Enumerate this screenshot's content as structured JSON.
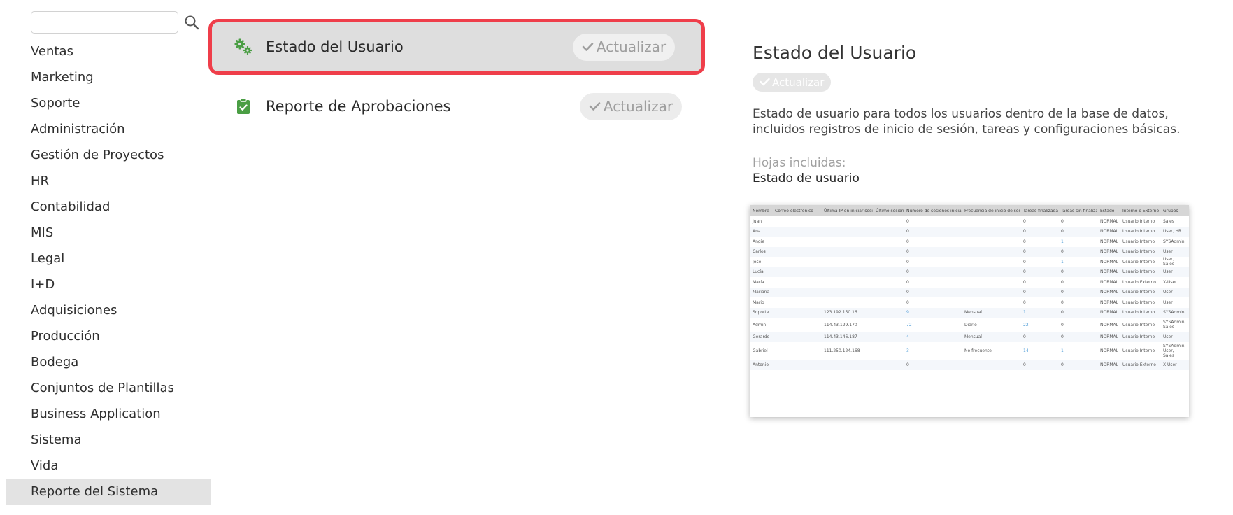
{
  "search": {
    "value": "",
    "placeholder": ""
  },
  "sidebar": {
    "items": [
      {
        "label": "Ventas",
        "active": false
      },
      {
        "label": "Marketing",
        "active": false
      },
      {
        "label": "Soporte",
        "active": false
      },
      {
        "label": "Administración",
        "active": false
      },
      {
        "label": "Gestión de Proyectos",
        "active": false
      },
      {
        "label": "HR",
        "active": false
      },
      {
        "label": "Contabilidad",
        "active": false
      },
      {
        "label": "MIS",
        "active": false
      },
      {
        "label": "Legal",
        "active": false
      },
      {
        "label": "I+D",
        "active": false
      },
      {
        "label": "Adquisiciones",
        "active": false
      },
      {
        "label": "Producción",
        "active": false
      },
      {
        "label": "Bodega",
        "active": false
      },
      {
        "label": "Conjuntos de Plantillas",
        "active": false
      },
      {
        "label": "Business Application",
        "active": false
      },
      {
        "label": "Sistema",
        "active": false
      },
      {
        "label": "Vida",
        "active": false
      },
      {
        "label": "Reporte del Sistema",
        "active": true
      }
    ]
  },
  "reports": [
    {
      "title": "Estado del Usuario",
      "button": "Actualizar",
      "icon": "gears-icon",
      "selected": true
    },
    {
      "title": "Reporte de Aprobaciones",
      "button": "Actualizar",
      "icon": "clipboard-check-icon",
      "selected": false
    }
  ],
  "detail": {
    "title": "Estado del Usuario",
    "badge": "Actualizar",
    "description": "Estado de usuario para todos los usuarios dentro de la base de datos, incluidos registros de inicio de sesión, tareas y configuraciones básicas.",
    "sheets_label": "Hojas incluidas:",
    "sheets_value": "Estado de usuario"
  },
  "preview": {
    "columns": [
      "Nombre",
      "Correo electrónico",
      "Última IP en iniciar sesión",
      "Último sesión",
      "Número de sesiones iniciadas",
      "Frecuencia de inicio de sesión",
      "Tareas finalizadas",
      "Tareas sin finalizar",
      "Estado",
      "Interno o Externo",
      "Grupos"
    ],
    "rows": [
      [
        "Juan",
        "",
        "",
        "",
        "0",
        "",
        "0",
        "0",
        "NORMAL",
        "Usuario Interno",
        "Sales"
      ],
      [
        "Ana",
        "",
        "",
        "",
        "0",
        "",
        "0",
        "0",
        "NORMAL",
        "Usuario Interno",
        "User, HR"
      ],
      [
        "Angie",
        "",
        "",
        "",
        "0",
        "",
        "0",
        "1",
        "NORMAL",
        "Usuario Interno",
        "SYSAdmin"
      ],
      [
        "Carlos",
        "",
        "",
        "",
        "0",
        "",
        "0",
        "0",
        "NORMAL",
        "Usuario Interno",
        "User"
      ],
      [
        "José",
        "",
        "",
        "",
        "0",
        "",
        "0",
        "1",
        "NORMAL",
        "Usuario Interno",
        "User, Sales"
      ],
      [
        "Lucía",
        "",
        "",
        "",
        "0",
        "",
        "0",
        "0",
        "NORMAL",
        "Usuario Interno",
        "User"
      ],
      [
        "María",
        "",
        "",
        "",
        "0",
        "",
        "0",
        "0",
        "NORMAL",
        "Usuario Externo",
        "X-User"
      ],
      [
        "Mariana",
        "",
        "",
        "",
        "0",
        "",
        "0",
        "0",
        "NORMAL",
        "Usuario Interno",
        "User"
      ],
      [
        "Mario",
        "",
        "",
        "",
        "0",
        "",
        "0",
        "0",
        "NORMAL",
        "Usuario Interno",
        "User"
      ],
      [
        "Soporte",
        "",
        "123.192.150.16",
        "",
        "9",
        "Mensual",
        "1",
        "0",
        "NORMAL",
        "Usuario Interno",
        "SYSAdmin"
      ],
      [
        "Admin",
        "",
        "114.43.129.170",
        "",
        "72",
        "Diario",
        "22",
        "0",
        "NORMAL",
        "Usuario Interno",
        "SYSAdmin, Sales"
      ],
      [
        "Gerardo",
        "",
        "114.43.146.187",
        "",
        "4",
        "Mensual",
        "0",
        "0",
        "NORMAL",
        "Usuario Interno",
        "User"
      ],
      [
        "Gabriel",
        "",
        "111.250.124.168",
        "",
        "3",
        "No frecuente",
        "14",
        "1",
        "NORMAL",
        "Usuario Interno",
        "SYSAdmin, User, Sales"
      ],
      [
        "Antonio",
        "",
        "",
        "",
        "0",
        "",
        "0",
        "0",
        "NORMAL",
        "Usuario Externo",
        "X-User"
      ]
    ],
    "link_columns": [
      4,
      6,
      7
    ]
  },
  "colors": {
    "highlight_border": "#ef3e4a",
    "icon_green": "#4a9e44",
    "link_blue": "#4a9ad6",
    "active_bg": "#e3e3e3"
  }
}
